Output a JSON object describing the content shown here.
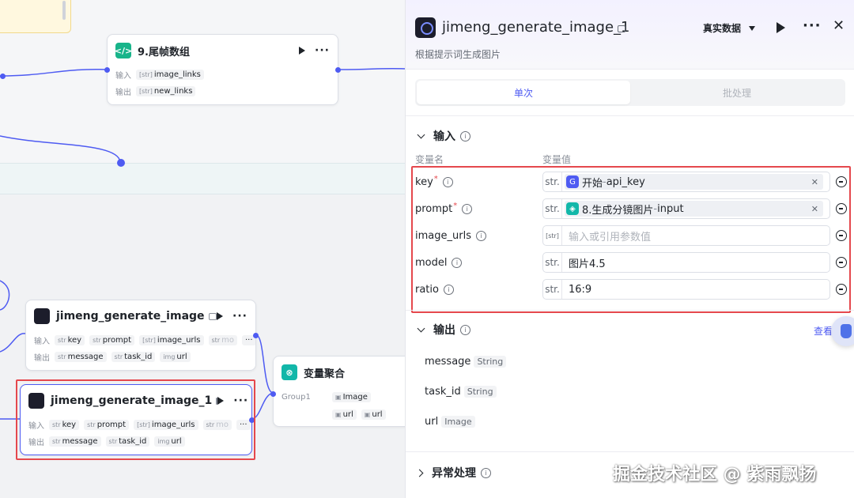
{
  "canvas": {
    "node_tail": {
      "title": "9.尾帧数组",
      "in_label": "输入",
      "out_label": "输出",
      "input": {
        "type": "[str]",
        "name": "image_links"
      },
      "output": {
        "type": "[str]",
        "name": "new_links"
      }
    },
    "node_gen": {
      "title": "jimeng_generate_image",
      "in_label": "输入",
      "out_label": "输出",
      "inputs": [
        {
          "type": "str",
          "name": "key"
        },
        {
          "type": "str",
          "name": "prompt"
        },
        {
          "type": "[str]",
          "name": "image_urls"
        },
        {
          "type": "str",
          "name": "mo"
        }
      ],
      "outputs": [
        {
          "type": "str",
          "name": "message"
        },
        {
          "type": "str",
          "name": "task_id"
        },
        {
          "type": "img",
          "name": "url"
        }
      ]
    },
    "node_gen1": {
      "title": "jimeng_generate_image_1",
      "in_label": "输入",
      "out_label": "输出",
      "inputs": [
        {
          "type": "str",
          "name": "key"
        },
        {
          "type": "str",
          "name": "prompt"
        },
        {
          "type": "[str]",
          "name": "image_urls"
        },
        {
          "type": "str",
          "name": "mo"
        }
      ],
      "outputs": [
        {
          "type": "str",
          "name": "message"
        },
        {
          "type": "str",
          "name": "task_id"
        },
        {
          "type": "img",
          "name": "url"
        }
      ]
    },
    "node_agg": {
      "title": "变量聚合",
      "group": "Group1",
      "items": [
        "Image",
        "url",
        "url"
      ]
    }
  },
  "panel": {
    "title": "jimeng_generate_image_1",
    "subtitle": "根据提示词生成图片",
    "mode": "真实数据",
    "tabs": [
      {
        "label": "单次",
        "active": true
      },
      {
        "label": "批处理",
        "active": false
      }
    ],
    "input_section": {
      "title": "输入",
      "col_name": "变量名",
      "col_value": "变量值",
      "rows": [
        {
          "name": "key",
          "required": true,
          "type": "str.",
          "ref": {
            "source": "开始",
            "field": "api_key",
            "sep": " - "
          }
        },
        {
          "name": "prompt",
          "required": true,
          "type": "str.",
          "ref": {
            "source": "8.生成分镜图片",
            "field": "input",
            "sep": " - "
          }
        },
        {
          "name": "image_urls",
          "required": false,
          "type": "[str]",
          "placeholder": "输入或引用参数值"
        },
        {
          "name": "model",
          "required": false,
          "type": "str.",
          "value": "图片4.5"
        },
        {
          "name": "ratio",
          "required": false,
          "type": "str.",
          "value": "16:9"
        }
      ]
    },
    "output_section": {
      "title": "输出",
      "view_link": "查看",
      "rows": [
        {
          "name": "message",
          "type": "String"
        },
        {
          "name": "task_id",
          "type": "String"
        },
        {
          "name": "url",
          "type": "Image"
        }
      ]
    },
    "error_section": {
      "title": "异常处理"
    }
  },
  "watermark": "掘金技术社区 @ 紫雨飘扬",
  "colors": {
    "accent": "#4e5bf2",
    "highlight": "#e5484d",
    "teal": "#12b7a9"
  }
}
